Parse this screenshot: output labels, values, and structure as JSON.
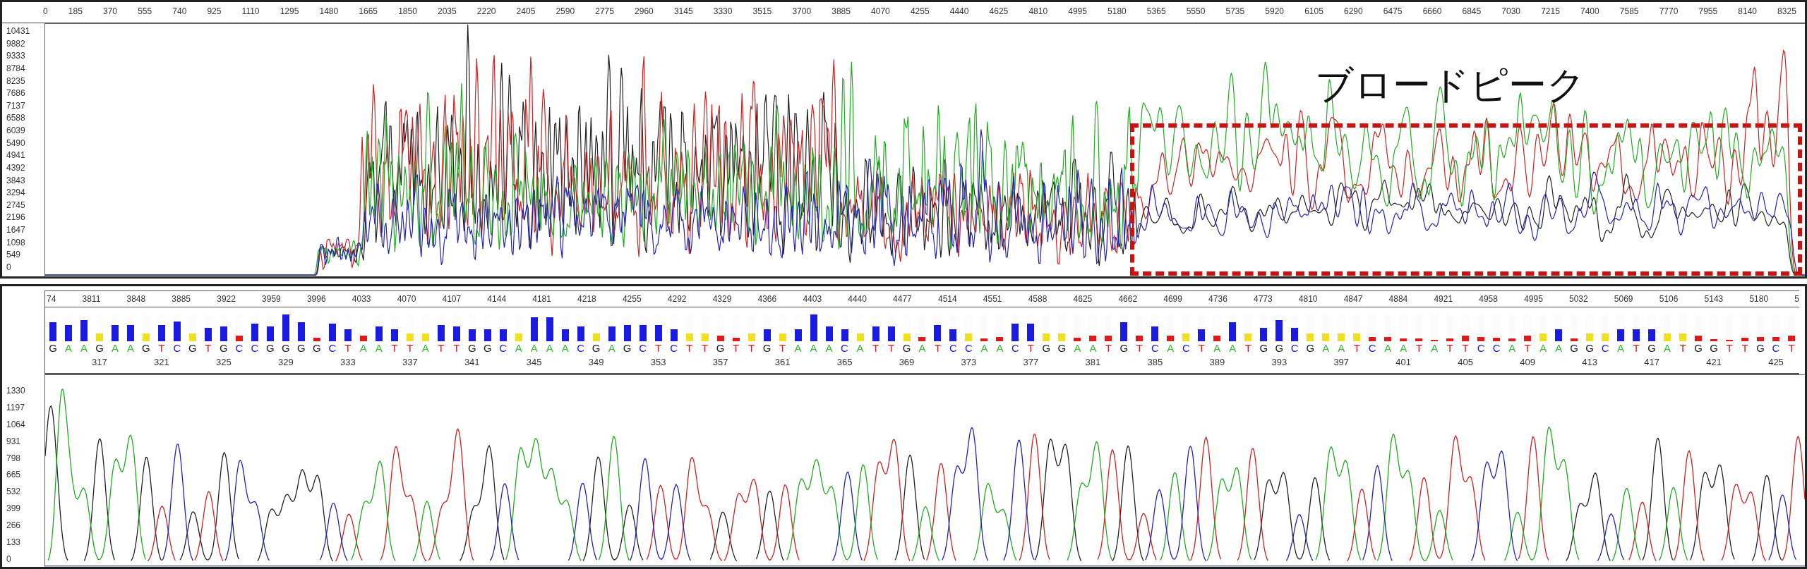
{
  "overview": {
    "x_axis": [
      "0",
      "185",
      "370",
      "555",
      "740",
      "925",
      "1110",
      "1295",
      "1480",
      "1665",
      "1850",
      "2035",
      "2220",
      "2405",
      "2590",
      "2775",
      "2960",
      "3145",
      "3330",
      "3515",
      "3700",
      "3885",
      "4070",
      "4255",
      "4440",
      "4625",
      "4810",
      "4995",
      "5180",
      "5365",
      "5550",
      "5735",
      "5920",
      "6105",
      "6290",
      "6475",
      "6660",
      "6845",
      "7030",
      "7215",
      "7400",
      "7585",
      "7770",
      "7955",
      "8140",
      "8325"
    ],
    "y_axis": [
      "10431",
      "9882",
      "9333",
      "8784",
      "8235",
      "7686",
      "7137",
      "6588",
      "6039",
      "5490",
      "4941",
      "4392",
      "3843",
      "3294",
      "2745",
      "2196",
      "1647",
      "1098",
      "549",
      "0"
    ],
    "annotation": {
      "label": "ブロードピーク"
    }
  },
  "detail": {
    "scan_axis": [
      "74",
      "3811",
      "3848",
      "3885",
      "3922",
      "3959",
      "3996",
      "4033",
      "4070",
      "4107",
      "4144",
      "4181",
      "4218",
      "4255",
      "4292",
      "4329",
      "4366",
      "4403",
      "4440",
      "4477",
      "4514",
      "4551",
      "4588",
      "4625",
      "4662",
      "4699",
      "4736",
      "4773",
      "4810",
      "4847",
      "4884",
      "4921",
      "4958",
      "4995",
      "5032",
      "5069",
      "5106",
      "5143",
      "5180",
      "5"
    ],
    "bases": [
      {
        "base": "G",
        "color": "#222222",
        "level": 0.7
      },
      {
        "base": "A",
        "color": "#33bb33",
        "level": 0.6
      },
      {
        "base": "A",
        "color": "#33bb33",
        "level": 0.8
      },
      {
        "base": "G",
        "color": "#222222",
        "level": 0.3
      },
      {
        "base": "A",
        "color": "#33bb33",
        "level": 0.6
      },
      {
        "base": "A",
        "color": "#33bb33",
        "level": 0.6
      },
      {
        "base": "G",
        "color": "#222222",
        "level": 0.3
      },
      {
        "base": "T",
        "color": "#cc2222",
        "level": 0.6
      },
      {
        "base": "C",
        "color": "#2222cc",
        "level": 0.75
      },
      {
        "base": "G",
        "color": "#222222",
        "level": 0.3
      },
      {
        "base": "T",
        "color": "#cc2222",
        "level": 0.5
      },
      {
        "base": "G",
        "color": "#222222",
        "level": 0.55
      },
      {
        "base": "C",
        "color": "#2222cc",
        "level": 0.2
      },
      {
        "base": "C",
        "color": "#2222cc",
        "level": 0.65
      },
      {
        "base": "G",
        "color": "#222222",
        "level": 0.55
      },
      {
        "base": "G",
        "color": "#222222",
        "level": 1.0
      },
      {
        "base": "G",
        "color": "#222222",
        "level": 0.7
      },
      {
        "base": "G",
        "color": "#222222",
        "level": 0.12
      },
      {
        "base": "C",
        "color": "#2222cc",
        "level": 0.65
      },
      {
        "base": "T",
        "color": "#cc2222",
        "level": 0.45
      },
      {
        "base": "A",
        "color": "#33bb33",
        "level": 0.2
      },
      {
        "base": "A",
        "color": "#33bb33",
        "level": 0.55
      },
      {
        "base": "T",
        "color": "#cc2222",
        "level": 0.45
      },
      {
        "base": "T",
        "color": "#cc2222",
        "level": 0.3
      },
      {
        "base": "A",
        "color": "#33bb33",
        "level": 0.3
      },
      {
        "base": "T",
        "color": "#cc2222",
        "level": 0.6
      },
      {
        "base": "T",
        "color": "#cc2222",
        "level": 0.55
      },
      {
        "base": "G",
        "color": "#222222",
        "level": 0.45
      },
      {
        "base": "G",
        "color": "#222222",
        "level": 0.45
      },
      {
        "base": "C",
        "color": "#2222cc",
        "level": 0.45
      },
      {
        "base": "A",
        "color": "#33bb33",
        "level": 0.3
      },
      {
        "base": "A",
        "color": "#33bb33",
        "level": 0.9
      },
      {
        "base": "A",
        "color": "#33bb33",
        "level": 0.9
      },
      {
        "base": "A",
        "color": "#33bb33",
        "level": 0.45
      },
      {
        "base": "C",
        "color": "#2222cc",
        "level": 0.55
      },
      {
        "base": "G",
        "color": "#222222",
        "level": 0.3
      },
      {
        "base": "A",
        "color": "#33bb33",
        "level": 0.55
      },
      {
        "base": "G",
        "color": "#222222",
        "level": 0.6
      },
      {
        "base": "C",
        "color": "#2222cc",
        "level": 0.6
      },
      {
        "base": "T",
        "color": "#cc2222",
        "level": 0.6
      },
      {
        "base": "C",
        "color": "#2222cc",
        "level": 0.45
      },
      {
        "base": "T",
        "color": "#cc2222",
        "level": 0.3
      },
      {
        "base": "T",
        "color": "#cc2222",
        "level": 0.3
      },
      {
        "base": "G",
        "color": "#222222",
        "level": 0.2
      },
      {
        "base": "T",
        "color": "#cc2222",
        "level": 0.12
      },
      {
        "base": "T",
        "color": "#cc2222",
        "level": 0.3
      },
      {
        "base": "G",
        "color": "#222222",
        "level": 0.45
      },
      {
        "base": "T",
        "color": "#cc2222",
        "level": 0.3
      },
      {
        "base": "A",
        "color": "#33bb33",
        "level": 0.45
      },
      {
        "base": "A",
        "color": "#33bb33",
        "level": 1.0
      },
      {
        "base": "A",
        "color": "#33bb33",
        "level": 0.55
      },
      {
        "base": "C",
        "color": "#2222cc",
        "level": 0.45
      },
      {
        "base": "A",
        "color": "#33bb33",
        "level": 0.3
      },
      {
        "base": "T",
        "color": "#cc2222",
        "level": 0.55
      },
      {
        "base": "T",
        "color": "#cc2222",
        "level": 0.55
      },
      {
        "base": "G",
        "color": "#222222",
        "level": 0.3
      },
      {
        "base": "A",
        "color": "#33bb33",
        "level": 0.15
      },
      {
        "base": "T",
        "color": "#cc2222",
        "level": 0.6
      },
      {
        "base": "C",
        "color": "#2222cc",
        "level": 0.45
      },
      {
        "base": "C",
        "color": "#2222cc",
        "level": 0.3
      },
      {
        "base": "A",
        "color": "#33bb33",
        "level": 0.1
      },
      {
        "base": "A",
        "color": "#33bb33",
        "level": 0.15
      },
      {
        "base": "C",
        "color": "#2222cc",
        "level": 0.65
      },
      {
        "base": "T",
        "color": "#cc2222",
        "level": 0.65
      },
      {
        "base": "G",
        "color": "#222222",
        "level": 0.3
      },
      {
        "base": "G",
        "color": "#222222",
        "level": 0.3
      },
      {
        "base": "A",
        "color": "#33bb33",
        "level": 0.12
      },
      {
        "base": "A",
        "color": "#33bb33",
        "level": 0.2
      },
      {
        "base": "T",
        "color": "#cc2222",
        "level": 0.2
      },
      {
        "base": "G",
        "color": "#222222",
        "level": 0.7
      },
      {
        "base": "T",
        "color": "#cc2222",
        "level": 0.2
      },
      {
        "base": "C",
        "color": "#2222cc",
        "level": 0.55
      },
      {
        "base": "A",
        "color": "#33bb33",
        "level": 0.2
      },
      {
        "base": "C",
        "color": "#2222cc",
        "level": 0.3
      },
      {
        "base": "T",
        "color": "#cc2222",
        "level": 0.45
      },
      {
        "base": "A",
        "color": "#33bb33",
        "level": 0.2
      },
      {
        "base": "A",
        "color": "#33bb33",
        "level": 0.7
      },
      {
        "base": "T",
        "color": "#cc2222",
        "level": 0.3
      },
      {
        "base": "G",
        "color": "#222222",
        "level": 0.5
      },
      {
        "base": "G",
        "color": "#222222",
        "level": 0.8
      },
      {
        "base": "C",
        "color": "#2222cc",
        "level": 0.5
      },
      {
        "base": "G",
        "color": "#222222",
        "level": 0.3
      },
      {
        "base": "A",
        "color": "#33bb33",
        "level": 0.3
      },
      {
        "base": "A",
        "color": "#33bb33",
        "level": 0.3
      },
      {
        "base": "T",
        "color": "#cc2222",
        "level": 0.3
      },
      {
        "base": "C",
        "color": "#2222cc",
        "level": 0.15
      },
      {
        "base": "A",
        "color": "#33bb33",
        "level": 0.15
      },
      {
        "base": "A",
        "color": "#33bb33",
        "level": 0.1
      },
      {
        "base": "T",
        "color": "#cc2222",
        "level": 0.1
      },
      {
        "base": "A",
        "color": "#33bb33",
        "level": 0.06
      },
      {
        "base": "T",
        "color": "#cc2222",
        "level": 0.1
      },
      {
        "base": "T",
        "color": "#cc2222",
        "level": 0.2
      },
      {
        "base": "C",
        "color": "#2222cc",
        "level": 0.15
      },
      {
        "base": "C",
        "color": "#2222cc",
        "level": 0.12
      },
      {
        "base": "A",
        "color": "#33bb33",
        "level": 0.1
      },
      {
        "base": "T",
        "color": "#cc2222",
        "level": 0.2
      },
      {
        "base": "A",
        "color": "#33bb33",
        "level": 0.3
      },
      {
        "base": "A",
        "color": "#33bb33",
        "level": 0.45
      },
      {
        "base": "G",
        "color": "#222222",
        "level": 0.1
      },
      {
        "base": "G",
        "color": "#222222",
        "level": 0.3
      },
      {
        "base": "C",
        "color": "#2222cc",
        "level": 0.3
      },
      {
        "base": "A",
        "color": "#33bb33",
        "level": 0.45
      },
      {
        "base": "T",
        "color": "#cc2222",
        "level": 0.45
      },
      {
        "base": "G",
        "color": "#222222",
        "level": 0.45
      },
      {
        "base": "A",
        "color": "#33bb33",
        "level": 0.3
      },
      {
        "base": "T",
        "color": "#cc2222",
        "level": 0.3
      },
      {
        "base": "G",
        "color": "#222222",
        "level": 0.2
      },
      {
        "base": "G",
        "color": "#222222",
        "level": 0.08
      },
      {
        "base": "T",
        "color": "#cc2222",
        "level": 0.06
      },
      {
        "base": "T",
        "color": "#cc2222",
        "level": 0.12
      },
      {
        "base": "G",
        "color": "#222222",
        "level": 0.15
      },
      {
        "base": "C",
        "color": "#2222cc",
        "level": 0.15
      },
      {
        "base": "T",
        "color": "#cc2222",
        "level": 0.2
      }
    ],
    "positions": [
      "317",
      "321",
      "325",
      "329",
      "333",
      "337",
      "341",
      "345",
      "349",
      "353",
      "357",
      "361",
      "365",
      "369",
      "373",
      "377",
      "381",
      "385",
      "389",
      "393",
      "397",
      "401",
      "405",
      "409",
      "413",
      "417",
      "421",
      "425"
    ],
    "y_axis": [
      "1330",
      "1197",
      "1064",
      "931",
      "798",
      "665",
      "532",
      "399",
      "266",
      "133",
      "0"
    ]
  }
}
